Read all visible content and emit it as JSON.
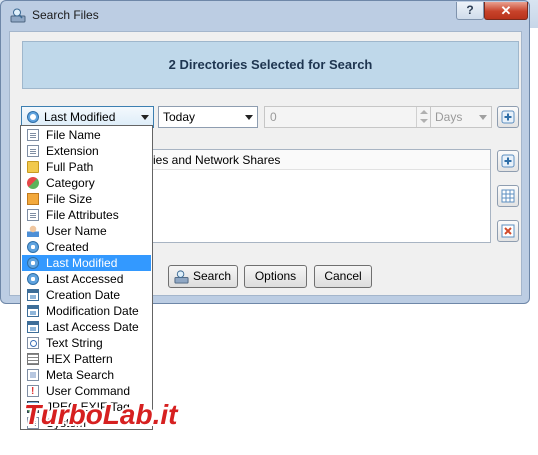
{
  "window": {
    "title": "Search Files",
    "help_label": "?",
    "close_label": "✕"
  },
  "banner": {
    "text": "2 Directories Selected for Search"
  },
  "criteria": {
    "field_selected": "Last Modified",
    "operator_selected": "Today",
    "value": "0",
    "unit_selected": "Days"
  },
  "list": {
    "header": "ries and Network Shares"
  },
  "buttons": {
    "search": "Search",
    "options": "Options",
    "cancel": "Cancel"
  },
  "dropdown": {
    "items": [
      {
        "label": "File Name",
        "icon": "document-icon"
      },
      {
        "label": "Extension",
        "icon": "document-icon"
      },
      {
        "label": "Full Path",
        "icon": "folder-icon"
      },
      {
        "label": "Category",
        "icon": "category-icon"
      },
      {
        "label": "File Size",
        "icon": "box-icon"
      },
      {
        "label": "File Attributes",
        "icon": "document-icon"
      },
      {
        "label": "User Name",
        "icon": "user-icon"
      },
      {
        "label": "Created",
        "icon": "clock-icon"
      },
      {
        "label": "Last Modified",
        "icon": "clock-icon",
        "selected": true
      },
      {
        "label": "Last Accessed",
        "icon": "clock-icon"
      },
      {
        "label": "Creation Date",
        "icon": "calendar-icon"
      },
      {
        "label": "Modification Date",
        "icon": "calendar-icon"
      },
      {
        "label": "Last Access Date",
        "icon": "calendar-icon"
      },
      {
        "label": "Text String",
        "icon": "text-icon"
      },
      {
        "label": "HEX Pattern",
        "icon": "hex-icon"
      },
      {
        "label": "Meta Search",
        "icon": "meta-icon"
      },
      {
        "label": "User Command",
        "icon": "command-icon"
      },
      {
        "label": "JPEG EXIF Tag",
        "icon": "jpeg-icon"
      },
      {
        "label": "System",
        "icon": "document-icon"
      }
    ]
  },
  "watermark": {
    "text": "TurboLab.it"
  },
  "colors": {
    "selection": "#3399ff",
    "banner_bg": "#bfd8ea",
    "window_frame": "#bccde3",
    "close_red": "#c7422a",
    "watermark_red": "#d62020"
  }
}
